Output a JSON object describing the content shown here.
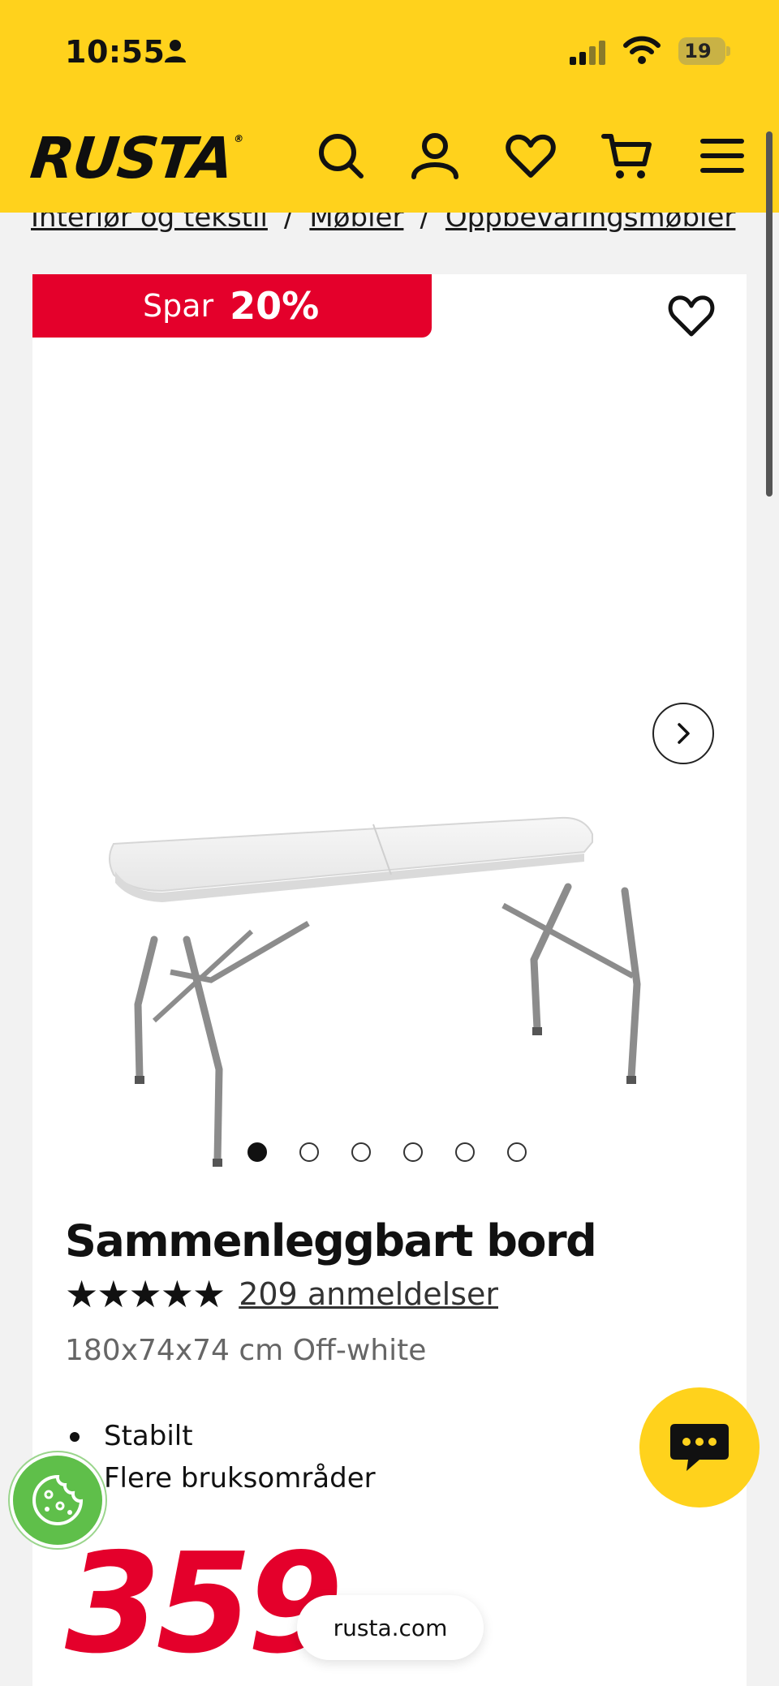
{
  "status_bar": {
    "time": "10:55",
    "battery": "19"
  },
  "nav": {
    "logo": "RUSTA",
    "icons": [
      "search-icon",
      "account-icon",
      "heart-icon",
      "cart-icon",
      "menu-icon"
    ]
  },
  "breadcrumb": {
    "items": [
      "Interiør og tekstil",
      "Møbler",
      "Oppbevaringsmøbler"
    ],
    "separator": "/"
  },
  "product": {
    "badge": {
      "label": "Spar",
      "value": "20%"
    },
    "image_count": 6,
    "active_image": 1,
    "title": "Sammenleggbart bord",
    "stars": "★★★★★",
    "reviews": "209 anmeldelser",
    "variant": "180x74x74 cm Off-white",
    "features": [
      "Stabilt",
      "Flere bruksområder"
    ],
    "price": "359."
  },
  "floating": {
    "url": "rusta.com"
  },
  "colors": {
    "brand_yellow": "#ffd21c",
    "sale_red": "#e4002b",
    "cookie_green": "#5fbf4a"
  }
}
